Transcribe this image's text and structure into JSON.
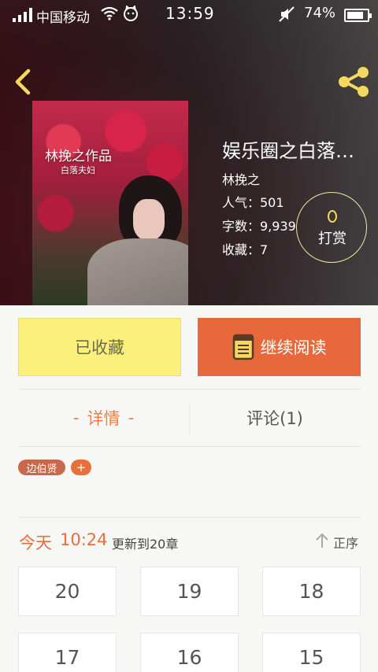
{
  "status_bar": {
    "carrier": "中国移动",
    "time": "13:59",
    "battery": "74%",
    "battery_level": 0.74
  },
  "nav": {
    "back_icon": "chevron-left-icon",
    "share_icon": "share-icon",
    "icon_color": "#f4d860"
  },
  "cover": {
    "author_line": "林挽之作品",
    "sub_line": "白落夫妇"
  },
  "book": {
    "title": "娱乐圈之白落…",
    "author": "林挽之",
    "popularity": "人气：501",
    "words": "字数：9,939",
    "favorites": "收藏：7"
  },
  "tip": {
    "label": "打赏",
    "icon": "coin-icon"
  },
  "actions": {
    "collected_label": "已收藏",
    "continue_label": "继续阅读",
    "collected_color": "#fbf07b",
    "continue_color": "#e7693b"
  },
  "tabs": {
    "details_label": "详情",
    "details_dash_left": "-",
    "details_dash_right": "-",
    "comments_label": "评论(1)"
  },
  "tags": {
    "items": [
      "边伯贤"
    ],
    "add_label": "+"
  },
  "update": {
    "day": "今天",
    "time": "10:24",
    "text": "更新到20章",
    "sort_label": "正序"
  },
  "chapters": [
    "20",
    "19",
    "18",
    "17",
    "16",
    "15"
  ]
}
